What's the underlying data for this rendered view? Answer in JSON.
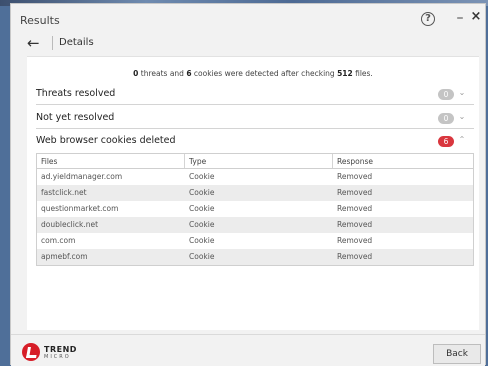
{
  "window": {
    "title": "Results",
    "help_glyph": "?",
    "minimize_glyph": "–",
    "close_glyph": "×"
  },
  "nav": {
    "back_glyph": "←",
    "title": "Details"
  },
  "summary": {
    "threats_count": "0",
    "text_a": " threats and ",
    "cookies_count": "6",
    "text_b": " cookies were detected after checking ",
    "files_count": "512",
    "text_c": " files."
  },
  "sections": [
    {
      "label": "Threats resolved",
      "count": "0",
      "badge_color": "#c4c4c4",
      "chevron": "⌄"
    },
    {
      "label": "Not yet resolved",
      "count": "0",
      "badge_color": "#c4c4c4",
      "chevron": "⌄"
    },
    {
      "label": "Web browser cookies deleted",
      "count": "6",
      "badge_color": "#d9363e",
      "chevron": "⌃"
    }
  ],
  "table": {
    "headers": [
      "Files",
      "Type",
      "Response"
    ],
    "rows": [
      [
        "ad.yieldmanager.com",
        "Cookie",
        "Removed"
      ],
      [
        "fastclick.net",
        "Cookie",
        "Removed"
      ],
      [
        "questionmarket.com",
        "Cookie",
        "Removed"
      ],
      [
        "doubleclick.net",
        "Cookie",
        "Removed"
      ],
      [
        "com.com",
        "Cookie",
        "Removed"
      ],
      [
        "apmebf.com",
        "Cookie",
        "Removed"
      ]
    ]
  },
  "footer": {
    "logo_line1": "TREND",
    "logo_line2": "MICRO",
    "back_button": "Back"
  }
}
